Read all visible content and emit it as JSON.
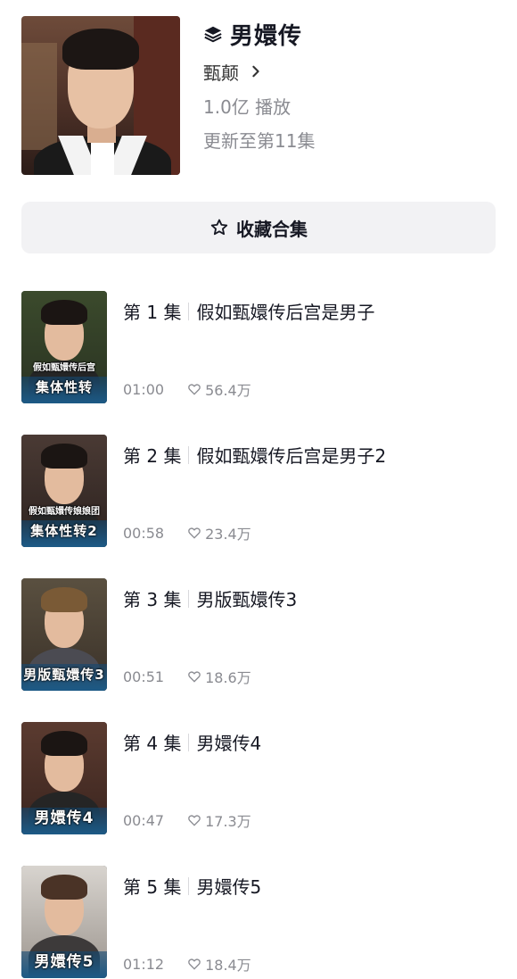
{
  "collection": {
    "title": "男嬛传",
    "author": "甄颠",
    "plays": "1.0亿 播放",
    "update_status": "更新至第11集"
  },
  "collect_button": {
    "label": "收藏合集"
  },
  "episodes": [
    {
      "number": "第 1 集",
      "title": "假如甄嬛传后宫是男子",
      "duration": "01:00",
      "likes": "56.4万",
      "thumb_caption_top": "假如甄嬛传后宫",
      "thumb_caption_main": "集体性转"
    },
    {
      "number": "第 2 集",
      "title": "假如甄嬛传后宫是男子2",
      "duration": "00:58",
      "likes": "23.4万",
      "thumb_caption_top": "假如甄嬛传娘娘团",
      "thumb_caption_main": "集体性转2"
    },
    {
      "number": "第 3 集",
      "title": "男版甄嬛传3",
      "duration": "00:51",
      "likes": "18.6万",
      "thumb_caption_top": "",
      "thumb_caption_main": "男版甄嬛传3"
    },
    {
      "number": "第 4 集",
      "title": "男嬛传4",
      "duration": "00:47",
      "likes": "17.3万",
      "thumb_caption_top": "",
      "thumb_caption_main": "男嬛传4"
    },
    {
      "number": "第 5 集",
      "title": "男嬛传5",
      "duration": "01:12",
      "likes": "18.4万",
      "thumb_caption_top": "",
      "thumb_caption_main": "男嬛传5"
    }
  ],
  "icons": {
    "collection": "layers-icon",
    "author_link": "chevron-right-icon",
    "collect": "star-outline-icon",
    "like": "heart-outline-icon"
  },
  "colors": {
    "text_primary": "#161823",
    "text_secondary": "#8a8b91",
    "button_bg": "#f2f2f4",
    "thumb_band": "#1d5a86"
  }
}
